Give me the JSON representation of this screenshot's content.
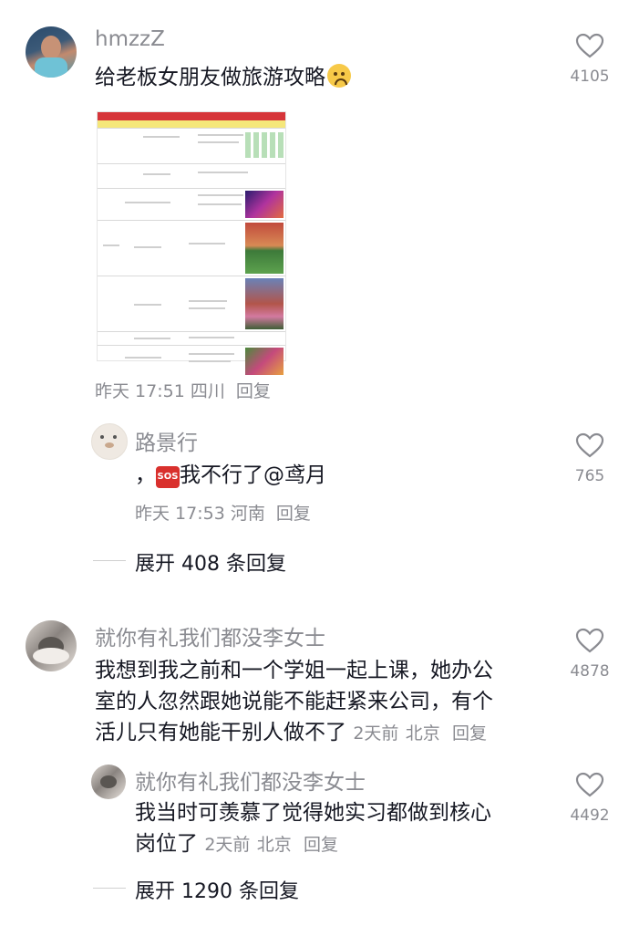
{
  "comments": [
    {
      "user": "hmzzZ",
      "text": "给老板女朋友做旅游攻略",
      "time": "昨天 17:51",
      "location": "四川",
      "reply_label": "回复",
      "likes": "4105",
      "emoji_icon": "upside-down-face-icon",
      "attachment": "spreadsheet-screenshot",
      "replies": [
        {
          "user": "路景行",
          "prefix": "，",
          "badge": "SOS",
          "text": "我不行了@鸢月",
          "time": "昨天 17:53",
          "location": "河南",
          "reply_label": "回复",
          "likes": "765"
        }
      ],
      "expand": "展开 408 条回复"
    },
    {
      "user": "就你有礼我们都没李女士",
      "text_line1": "我想到我之前和一个学姐一起上课，她办公",
      "text_line2": "室的人忽然跟她说能不能赶紧来公司，有个",
      "text_line3": "活儿只有她能干别人做不了",
      "time": "2天前",
      "location": "北京",
      "reply_label": "回复",
      "likes": "4878",
      "replies": [
        {
          "user": "就你有礼我们都没李女士",
          "text_line1": "我当时可羡慕了觉得她实习都做到核心",
          "text_line2": "岗位了",
          "time": "2天前",
          "location": "北京",
          "reply_label": "回复",
          "likes": "4492"
        }
      ],
      "expand": "展开 1290 条回复"
    }
  ],
  "colors": {
    "like_icon": "#8a8b91",
    "sos_badge": "#d9302d",
    "sheet_header": "#d6353a",
    "sheet_subheader": "#f5e77a"
  }
}
